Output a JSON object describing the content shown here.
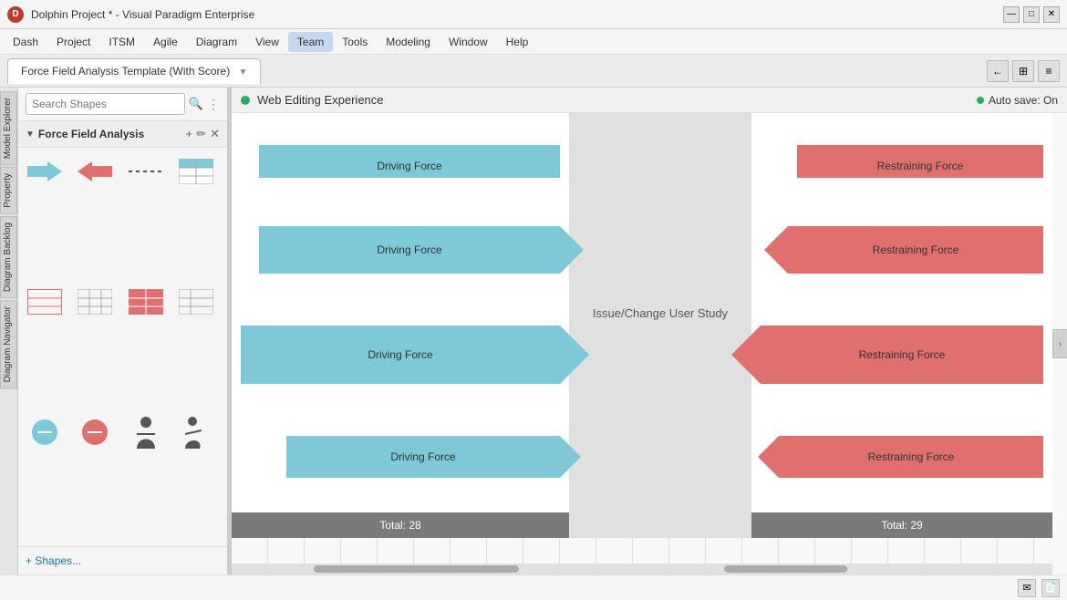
{
  "app": {
    "title": "Dolphin Project * - Visual Paradigm Enterprise",
    "icon": "D"
  },
  "titlebar": {
    "minimize": "—",
    "maximize": "□",
    "close": "✕"
  },
  "menubar": {
    "items": [
      "Dash",
      "Project",
      "ITSM",
      "Agile",
      "Diagram",
      "View",
      "Team",
      "Tools",
      "Modeling",
      "Window",
      "Help"
    ]
  },
  "tab": {
    "label": "Force Field Analysis Template (With Score)",
    "icons": [
      "←",
      "⊞",
      "📋"
    ]
  },
  "toolbar": {
    "web_title": "Web Editing Experience",
    "autosave": "Auto save: On"
  },
  "search": {
    "placeholder": "Search Shapes"
  },
  "category": {
    "name": "Force Field Analysis",
    "add": "+",
    "edit": "✏",
    "close": "✕"
  },
  "diagram": {
    "left_label": "Issue/Change User Study",
    "driving_forces": [
      "Driving Force",
      "Driving Force",
      "Driving Force",
      "Driving Force"
    ],
    "restraining_forces": [
      "Restraining Force",
      "Restraining Force",
      "Restraining Force",
      "Restraining Force"
    ],
    "total_left": "Total: 28",
    "total_right": "Total: 29"
  },
  "sidebar": {
    "model_explorer": "Model Explorer",
    "property": "Property",
    "diagram_backlog": "Diagram Backlog",
    "diagram_navigator": "Diagram Navigator"
  },
  "shapes_footer": {
    "label": "+ Shapes..."
  },
  "statusbar": {
    "icons": [
      "✉",
      "📄"
    ]
  }
}
